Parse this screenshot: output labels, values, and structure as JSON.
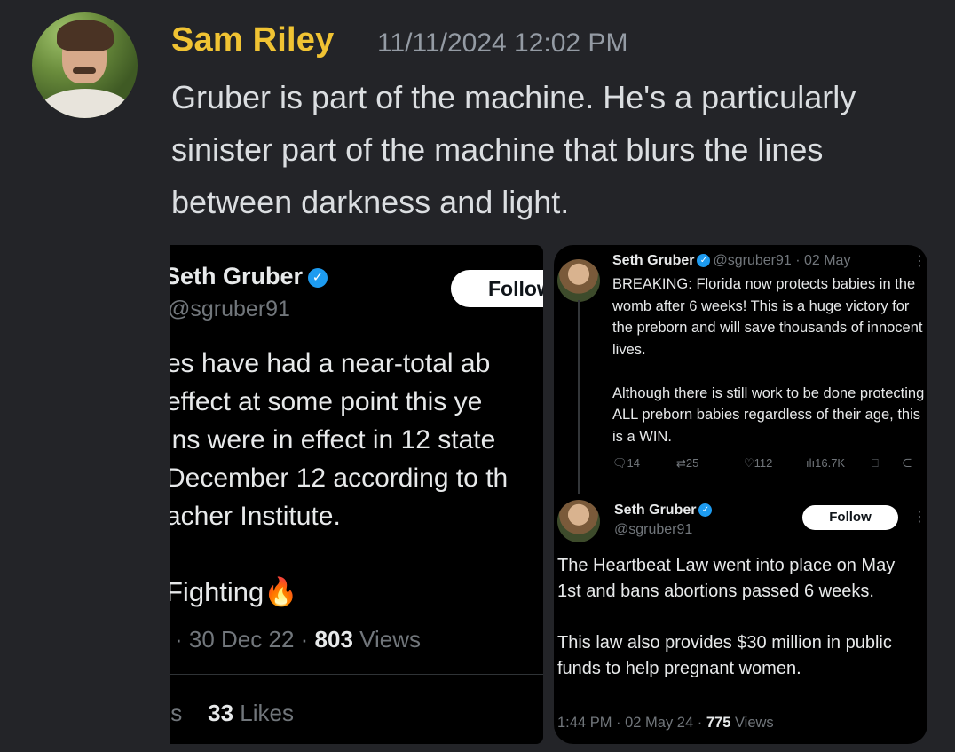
{
  "message": {
    "author": "Sam Riley",
    "timestamp": "11/11/2024 12:02 PM",
    "text": "Gruber is part of the machine. He's a particularly sinister part of the machine that blurs the lines between darkness and light.",
    "author_color": "#f0c333"
  },
  "left_tweet": {
    "name": "Seth Gruber",
    "handle": "@sgruber91",
    "follow_label": "Follow",
    "body_lines": [
      "es have had a near-total ab",
      "effect at some point this ye",
      "ins were in effect in 12 state",
      "December 12 according to th",
      "acher Institute."
    ],
    "tagline": "Fighting🔥",
    "date": "· 30 Dec 22 ·",
    "views_count": "803",
    "views_label": "Views",
    "stats_prefix": "ts",
    "likes_count": "33",
    "likes_label": "Likes"
  },
  "right_tweet": {
    "first": {
      "name": "Seth Gruber",
      "handle_date": "@sgruber91 · 02 May",
      "text": "BREAKING: Florida now protects babies in the womb after 6 weeks! This is a huge victory for the preborn and will save thousands of innocent lives.\n\nAlthough there is still work to be done protecting ALL preborn babies regardless of their age, this is a WIN.",
      "replies": "14",
      "reposts": "25",
      "likes": "112",
      "views": "16.7K"
    },
    "second": {
      "name": "Seth Gruber",
      "handle": "@sgruber91",
      "follow_label": "Follow",
      "text": "The Heartbeat Law went into place on May 1st and bans abortions passed 6 weeks.\n\nThis law also provides $30 million in public funds to help pregnant women.",
      "meta": "1:44 PM · 02 May 24 ·",
      "views_count": "775",
      "views_label": "Views"
    }
  }
}
